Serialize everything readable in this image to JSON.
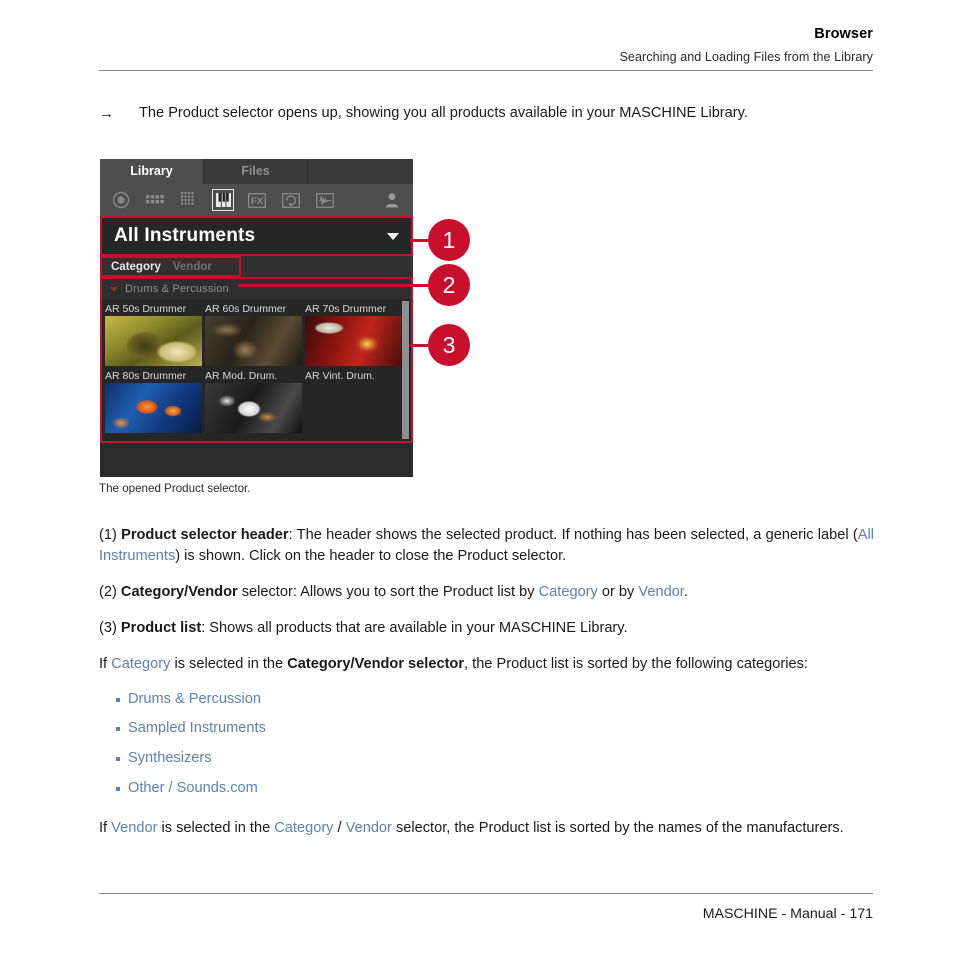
{
  "header": {
    "title": "Browser",
    "subtitle": "Searching and Loading Files from the Library"
  },
  "intro": {
    "arrow": "→",
    "text": "The Product selector opens up, showing you all products available in your MASCHINE Library."
  },
  "figure": {
    "caption": "The opened Product selector.",
    "tabs": [
      {
        "label": "Library",
        "state": "active"
      },
      {
        "label": "Files",
        "state": "inactive"
      }
    ],
    "toolbar_icons": [
      {
        "name": "all-icon",
        "selected": false
      },
      {
        "name": "drumkit-grid-icon",
        "selected": false
      },
      {
        "name": "fine-grid-icon",
        "selected": false
      },
      {
        "name": "piano-keys-icon",
        "selected": true
      },
      {
        "name": "fx-icon",
        "selected": false
      },
      {
        "name": "loop-sampler-icon",
        "selected": false
      },
      {
        "name": "waveform-icon",
        "selected": false
      },
      {
        "name": "user-icon",
        "selected": false
      }
    ],
    "product_selector": {
      "label": "All Instruments",
      "caret": "▼"
    },
    "catvendor": {
      "category": "Category",
      "vendor": "Vendor",
      "selected": "Category"
    },
    "product_list": {
      "group_label": "Drums & Percussion",
      "tiles": [
        {
          "name": "AR 50s Drummer",
          "art": "art-50"
        },
        {
          "name": "AR 60s Drummer",
          "art": "art-60"
        },
        {
          "name": "AR 70s Drummer",
          "art": "art-70"
        },
        {
          "name": "AR 80s Drummer",
          "art": "art-80"
        },
        {
          "name": "AR Mod. Drum.",
          "art": "art-mod"
        },
        {
          "name": "AR Vint. Drum.",
          "art": "art-vint"
        }
      ]
    },
    "callouts": [
      {
        "number": "1"
      },
      {
        "number": "2"
      },
      {
        "number": "3"
      }
    ]
  },
  "body": {
    "p1_num": "(1)",
    "p1_bold": "Product selector header",
    "p1_a": ": The header shows the selected product. If nothing has been selected, a generic label (",
    "p1_link": "All Instruments",
    "p1_b": ") is shown. Click on the header to close the Product selector.",
    "p2_num": "(2)",
    "p2_bold": "Category/Vendor",
    "p2_a": " selector: Allows you to sort the Product list by ",
    "p2_link1": "Category",
    "p2_b": " or by ",
    "p2_link2": "Vendor",
    "p2_c": ".",
    "p3_num": "(3)",
    "p3_bold": "Product list",
    "p3_a": ": Shows all products that are available in your MASCHINE Library.",
    "p4_a": "If ",
    "p4_link": "Category",
    "p4_b": " is selected in the ",
    "p4_bold": "Category/Vendor selector",
    "p4_c": ", the Product list is sorted by the following categories:",
    "bullets": [
      "Drums & Percussion",
      "Sampled Instruments",
      "Synthesizers",
      "Other / Sounds.com"
    ],
    "p5_a": "If ",
    "p5_link1": "Vendor",
    "p5_b": " is selected in the ",
    "p5_link2": "Category",
    "p5_c": " / ",
    "p5_link3": "Vendor",
    "p5_d": " selector, the Product list is sorted by the names of the manufacturers."
  },
  "footer": {
    "text": "MASCHINE - Manual - 171"
  },
  "colors": {
    "accent_red": "#c8102e",
    "link_blue": "#5b82b0",
    "panel_dark": "#262626"
  }
}
